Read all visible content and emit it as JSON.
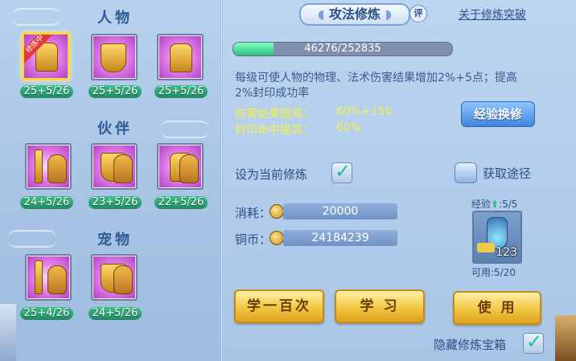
{
  "left": {
    "sections": [
      {
        "title": "人物"
      },
      {
        "title": "伙伴"
      },
      {
        "title": "宠物"
      }
    ],
    "character_slots": [
      {
        "level": "25+5/26",
        "badge": "修炼中",
        "icon": "golden-armor-icon"
      },
      {
        "level": "25+5/26",
        "icon": "golden-shield-armor-icon"
      },
      {
        "level": "25+5/26",
        "icon": "golden-figure-icon"
      }
    ],
    "partner_slots": [
      {
        "level": "24+5/26",
        "icon": "sword-tiger-icon"
      },
      {
        "level": "23+5/26",
        "icon": "shield-tiger-icon"
      },
      {
        "level": "22+5/26",
        "icon": "hand-tiger-icon"
      }
    ],
    "pet_slots": [
      {
        "level": "25+4/26",
        "icon": "sword-cat-icon"
      },
      {
        "level": "24+5/26",
        "icon": "shield-cat-icon"
      }
    ]
  },
  "right": {
    "tab_title": "攻法修炼",
    "rate_badge": "评",
    "breakthrough_link": "关于修炼突破",
    "xp": {
      "text": "46276/252835",
      "current": 46276,
      "max": 252835
    },
    "description": "每级可使人物的物理、法术伤害结果增加2%+5点；提高2%封印成功率",
    "stats": [
      {
        "label": "伤害结果提高：",
        "value": "60%+150"
      },
      {
        "label": "封印命中提高：",
        "value": "60%"
      }
    ],
    "exchange_button": "经验换修",
    "set_current_label": "设为当前修炼",
    "set_current_checked": true,
    "get_source_label": "获取途径",
    "cost_label": "消耗：",
    "cost_value": "20000",
    "copper_label": "铜币：",
    "copper_value": "24184239",
    "item": {
      "exp_label": "经验",
      "exp_value": ":5/5",
      "count": "123",
      "usable": "可用:5/20"
    },
    "buttons": {
      "learn_hundred": "学一百次",
      "learn": "学  习",
      "use": "使  用"
    },
    "hide_chest_label": "隐藏修炼宝箱",
    "hide_chest_checked": true
  }
}
